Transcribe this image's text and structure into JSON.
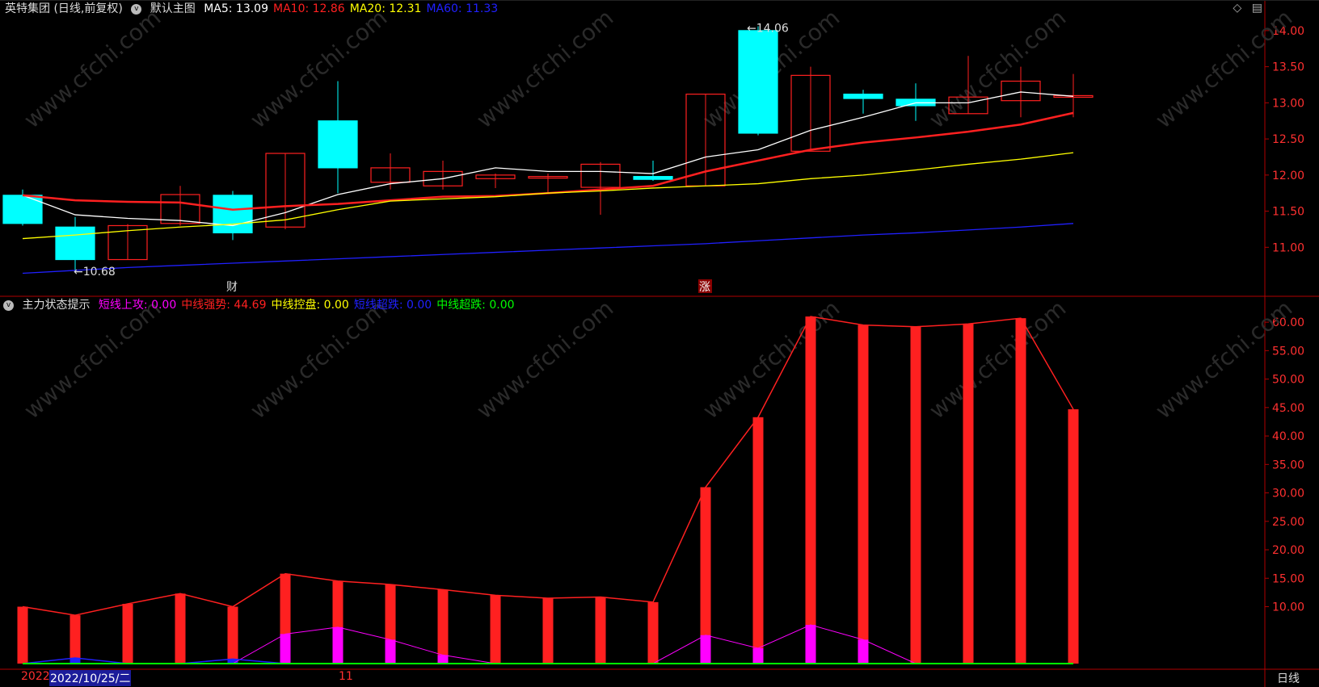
{
  "header": {
    "title": "英特集团 (日线,前复权)",
    "template": "默认主图",
    "ma": [
      {
        "label": "MA5: 13.09",
        "color": "#ffffff"
      },
      {
        "label": "MA10: 12.86",
        "color": "#ff2020"
      },
      {
        "label": "MA20: 12.31",
        "color": "#ffff00"
      },
      {
        "label": "MA60: 11.33",
        "color": "#2020ff"
      }
    ]
  },
  "indicator": {
    "title": "主力状态提示",
    "items": [
      {
        "label": "短线上攻: 0.00",
        "color": "#ff00ff"
      },
      {
        "label": "中线强势: 44.69",
        "color": "#ff2020"
      },
      {
        "label": "中线控盘: 0.00",
        "color": "#ffff00"
      },
      {
        "label": "短线超跌: 0.00",
        "color": "#2020ff"
      },
      {
        "label": "中线超跌: 0.00",
        "color": "#00ff00"
      }
    ]
  },
  "footer": {
    "year": "2022",
    "date": "2022/10/25/二",
    "month": "11",
    "period": "日线"
  },
  "markers": {
    "low": "←10.68",
    "high": "←14.06",
    "cai": "财",
    "zhang": "涨"
  },
  "colors": {
    "up": "#ff2020",
    "down": "#00ffff",
    "axis": "#b00000",
    "bg": "#000000"
  },
  "chart_data": [
    {
      "type": "candlestick",
      "ylim": [
        10.4,
        14.2
      ],
      "yticks": [
        "14.00",
        "13.50",
        "13.00",
        "12.50",
        "12.00",
        "11.50",
        "11.00"
      ],
      "candles": [
        {
          "o": 11.72,
          "h": 11.8,
          "l": 11.3,
          "c": 11.33
        },
        {
          "o": 11.28,
          "h": 11.42,
          "l": 10.68,
          "c": 10.83
        },
        {
          "o": 10.83,
          "h": 11.32,
          "l": 10.83,
          "c": 11.3
        },
        {
          "o": 11.33,
          "h": 11.85,
          "l": 11.3,
          "c": 11.73
        },
        {
          "o": 11.72,
          "h": 11.78,
          "l": 11.1,
          "c": 11.2
        },
        {
          "o": 11.28,
          "h": 12.3,
          "l": 11.25,
          "c": 12.3
        },
        {
          "o": 12.75,
          "h": 13.3,
          "l": 11.75,
          "c": 12.1
        },
        {
          "o": 11.9,
          "h": 12.3,
          "l": 11.8,
          "c": 12.1
        },
        {
          "o": 11.85,
          "h": 12.2,
          "l": 11.8,
          "c": 12.05
        },
        {
          "o": 11.95,
          "h": 12.02,
          "l": 11.82,
          "c": 12.0
        },
        {
          "o": 11.98,
          "h": 12.02,
          "l": 11.75,
          "c": 11.98
        },
        {
          "o": 11.83,
          "h": 12.18,
          "l": 11.45,
          "c": 12.15
        },
        {
          "o": 11.98,
          "h": 12.2,
          "l": 11.92,
          "c": 11.94
        },
        {
          "o": 11.85,
          "h": 13.12,
          "l": 11.85,
          "c": 13.12
        },
        {
          "o": 14.0,
          "h": 14.06,
          "l": 12.55,
          "c": 12.58
        },
        {
          "o": 12.33,
          "h": 13.5,
          "l": 12.33,
          "c": 13.38
        },
        {
          "o": 13.12,
          "h": 13.18,
          "l": 12.85,
          "c": 13.06
        },
        {
          "o": 13.05,
          "h": 13.27,
          "l": 12.75,
          "c": 12.96
        },
        {
          "o": 12.85,
          "h": 13.65,
          "l": 12.85,
          "c": 13.08
        },
        {
          "o": 13.03,
          "h": 13.5,
          "l": 12.8,
          "c": 13.3
        },
        {
          "o": 13.1,
          "h": 13.4,
          "l": 12.8,
          "c": 13.1
        }
      ],
      "series": [
        {
          "name": "MA5",
          "color": "#ffffff",
          "values": [
            11.72,
            11.45,
            11.4,
            11.37,
            11.3,
            11.48,
            11.73,
            11.88,
            11.95,
            12.1,
            12.05,
            12.05,
            12.02,
            12.25,
            12.35,
            12.62,
            12.8,
            13.0,
            13.0,
            13.15,
            13.09
          ]
        },
        {
          "name": "MA10",
          "color": "#ff2020",
          "values": [
            11.72,
            11.65,
            11.63,
            11.62,
            11.52,
            11.57,
            11.6,
            11.65,
            11.7,
            11.71,
            11.75,
            11.8,
            11.85,
            12.05,
            12.2,
            12.35,
            12.45,
            12.52,
            12.6,
            12.7,
            12.86
          ]
        },
        {
          "name": "MA20",
          "color": "#ffff00",
          "values": [
            11.12,
            11.17,
            11.23,
            11.28,
            11.32,
            11.38,
            11.52,
            11.64,
            11.67,
            11.7,
            11.75,
            11.78,
            11.82,
            11.85,
            11.88,
            11.95,
            12.0,
            12.07,
            12.15,
            12.22,
            12.31
          ]
        },
        {
          "name": "MA60",
          "color": "#2020ff",
          "values": [
            10.64,
            10.68,
            10.72,
            10.75,
            10.78,
            10.81,
            10.84,
            10.87,
            10.9,
            10.93,
            10.96,
            10.99,
            11.02,
            11.05,
            11.09,
            11.13,
            11.17,
            11.2,
            11.24,
            11.28,
            11.33
          ]
        }
      ]
    },
    {
      "type": "bar",
      "ylim": [
        0,
        62
      ],
      "yticks": [
        "60.00",
        "55.00",
        "50.00",
        "45.00",
        "40.00",
        "35.00",
        "30.00",
        "25.00",
        "20.00",
        "15.00",
        "10.00"
      ],
      "series": [
        {
          "name": "中线强势",
          "color": "#ff2020",
          "values": [
            10.0,
            8.5,
            10.5,
            12.3,
            10.0,
            15.8,
            14.5,
            13.9,
            13.0,
            12.0,
            11.5,
            11.7,
            10.8,
            31.0,
            43.3,
            61.0,
            59.5,
            59.2,
            59.7,
            60.7,
            44.7
          ]
        },
        {
          "name": "短线上攻",
          "color": "#ff00ff",
          "values": [
            0,
            0,
            0,
            0,
            0,
            5.2,
            6.4,
            4.2,
            1.5,
            0,
            0,
            0,
            0,
            5.0,
            2.7,
            6.8,
            4.2,
            0,
            0,
            0,
            0
          ]
        },
        {
          "name": "短线超跌",
          "color": "#2020ff",
          "values": [
            0,
            1.0,
            0,
            0,
            0.8,
            0,
            0,
            0,
            0,
            0,
            0,
            0,
            0,
            0,
            0,
            0,
            0,
            0,
            0,
            0,
            0
          ]
        }
      ]
    }
  ]
}
